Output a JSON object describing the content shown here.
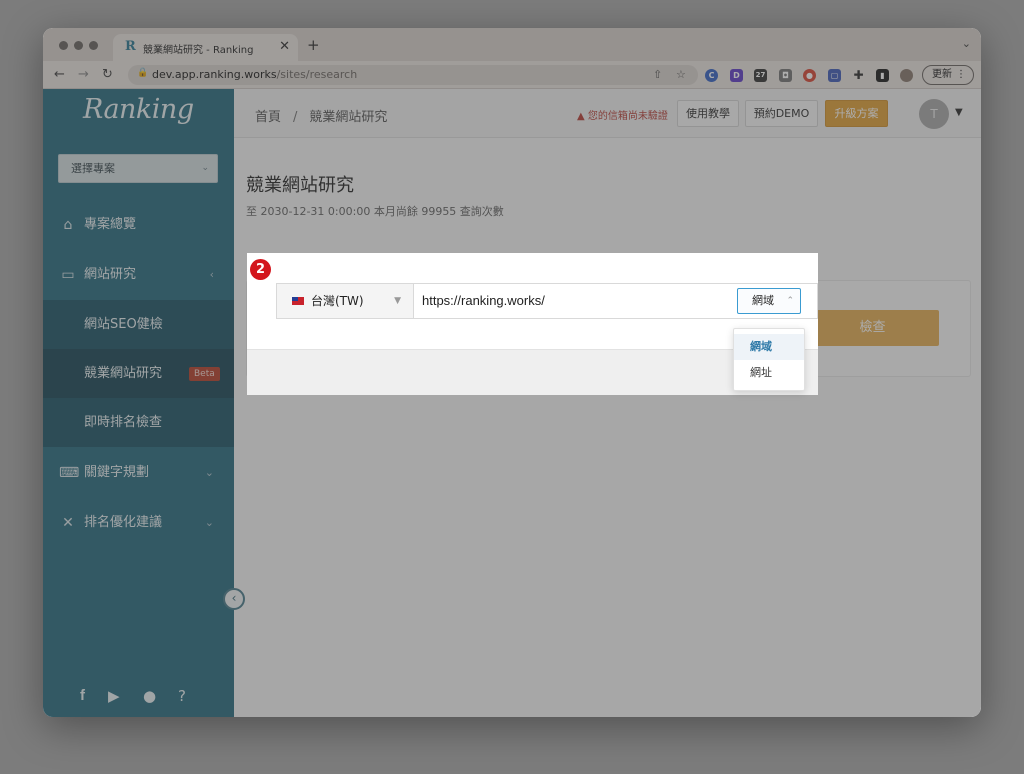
{
  "browser": {
    "tab_title": "競業網站研究 - Ranking",
    "tab_favicon": "R",
    "url_host": "dev.app.ranking.works",
    "url_path": "/sites/research",
    "update_label": "更新"
  },
  "sidebar": {
    "logo": "Ranking",
    "project_select": "選擇專案",
    "items": [
      {
        "label": "專案總覽",
        "icon": "home-icon"
      },
      {
        "label": "網站研究",
        "icon": "monitor-icon"
      },
      {
        "label": "關鍵字規劃",
        "icon": "keyword-icon"
      },
      {
        "label": "排名優化建議",
        "icon": "tools-icon"
      }
    ],
    "subitems": [
      {
        "label": "網站SEO健檢"
      },
      {
        "label": "競業網站研究",
        "badge": "Beta"
      },
      {
        "label": "即時排名檢查"
      }
    ]
  },
  "header": {
    "breadcrumb_home": "首頁",
    "breadcrumb_sep": "/",
    "breadcrumb_current": "競業網站研究",
    "warning": "您的信箱尚未驗證",
    "tutorial": "使用教學",
    "demo": "預約DEMO",
    "upgrade": "升級方案",
    "avatar_initial": "T"
  },
  "page": {
    "title": "競業網站研究",
    "subtitle": "至 2030-12-31 0:00:00 本月尚餘 99955 查詢次數",
    "check_button": "檢查"
  },
  "form": {
    "step": "2",
    "region": "台灣(TW)",
    "url_value": "https://ranking.works/",
    "type_selected": "網域",
    "type_options": [
      "網域",
      "網址"
    ]
  },
  "colors": {
    "sidebar": "#2e6e82",
    "accent": "#e0a23b",
    "badge": "#d3161d"
  }
}
